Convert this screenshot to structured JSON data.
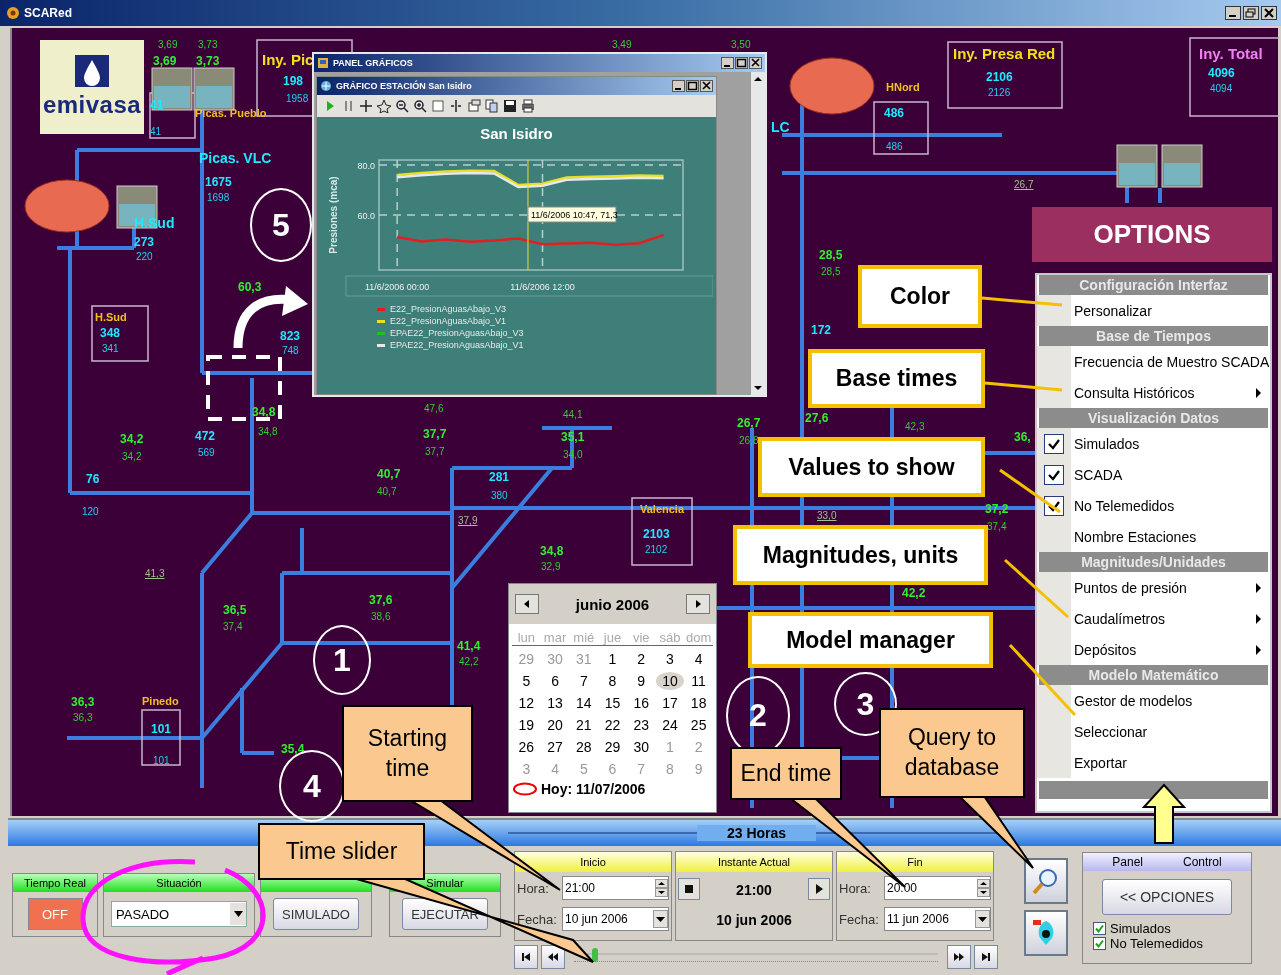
{
  "window": {
    "title": "SCARed"
  },
  "logo": {
    "text": "emivasa"
  },
  "diagram": {
    "labels": [
      {
        "text": "3,69",
        "kind": "reading_small"
      },
      {
        "text": "3,73",
        "kind": "reading_small"
      },
      {
        "text": "3,69",
        "kind": "reading"
      },
      {
        "text": "3,73",
        "kind": "reading"
      },
      {
        "text": "41",
        "kind": "flow"
      },
      {
        "text": "41",
        "kind": "flow_small"
      },
      {
        "text": "Picas. Pueblo",
        "kind": "station"
      },
      {
        "text": "Iny. Pic",
        "kind": "injection"
      },
      {
        "text": "198",
        "kind": "flow"
      },
      {
        "text": "1958",
        "kind": "flow_small"
      },
      {
        "text": "Picas. VLC",
        "kind": "station_big"
      },
      {
        "text": "1675",
        "kind": "flow"
      },
      {
        "text": "1698",
        "kind": "flow_small"
      },
      {
        "text": "H.Sud",
        "kind": "station_big"
      },
      {
        "text": "273",
        "kind": "flow"
      },
      {
        "text": "220",
        "kind": "flow_small"
      },
      {
        "text": "H.Sud",
        "kind": "station"
      },
      {
        "text": "348",
        "kind": "flow"
      },
      {
        "text": "341",
        "kind": "flow_small"
      },
      {
        "text": "60,3",
        "kind": "reading"
      },
      {
        "text": "823",
        "kind": "flow"
      },
      {
        "text": "748",
        "kind": "flow_small"
      },
      {
        "text": "34,8",
        "kind": "reading"
      },
      {
        "text": "34,8",
        "kind": "reading_small"
      },
      {
        "text": "34,2",
        "kind": "reading"
      },
      {
        "text": "34,2",
        "kind": "reading_small"
      },
      {
        "text": "472",
        "kind": "flow"
      },
      {
        "text": "569",
        "kind": "flow_small"
      },
      {
        "text": "76",
        "kind": "flow"
      },
      {
        "text": "120",
        "kind": "flow_small"
      },
      {
        "text": "47,6",
        "kind": "reading_small"
      },
      {
        "text": "44,1",
        "kind": "reading_small"
      },
      {
        "text": "37,7",
        "kind": "reading"
      },
      {
        "text": "37,7",
        "kind": "reading_small"
      },
      {
        "text": "35,1",
        "kind": "reading"
      },
      {
        "text": "34,0",
        "kind": "reading_small"
      },
      {
        "text": "40,7",
        "kind": "reading"
      },
      {
        "text": "40,7",
        "kind": "reading_small"
      },
      {
        "text": "281",
        "kind": "flow"
      },
      {
        "text": "380",
        "kind": "flow_small"
      },
      {
        "text": "37,9",
        "kind": "link"
      },
      {
        "text": "41,3",
        "kind": "link"
      },
      {
        "text": "34,8",
        "kind": "reading"
      },
      {
        "text": "32,9",
        "kind": "reading_small"
      },
      {
        "text": "36,5",
        "kind": "reading"
      },
      {
        "text": "37,4",
        "kind": "reading_small"
      },
      {
        "text": "37,6",
        "kind": "reading"
      },
      {
        "text": "38,6",
        "kind": "reading_small"
      },
      {
        "text": "41,4",
        "kind": "reading"
      },
      {
        "text": "42,2",
        "kind": "reading_small"
      },
      {
        "text": "36,3",
        "kind": "reading"
      },
      {
        "text": "36,3",
        "kind": "reading_small"
      },
      {
        "text": "Pinedo",
        "kind": "station"
      },
      {
        "text": "101",
        "kind": "flow"
      },
      {
        "text": "101",
        "kind": "flow_small"
      },
      {
        "text": "35,4",
        "kind": "reading"
      },
      {
        "text": "3,49",
        "kind": "reading_small"
      },
      {
        "text": "3,50",
        "kind": "reading_small"
      },
      {
        "text": "HNord",
        "kind": "station"
      },
      {
        "text": "486",
        "kind": "flow"
      },
      {
        "text": "486",
        "kind": "flow_small"
      },
      {
        "text": "Iny. Presa Red",
        "kind": "injection"
      },
      {
        "text": "2106",
        "kind": "flow"
      },
      {
        "text": "2126",
        "kind": "flow_small"
      },
      {
        "text": "Iny. Total",
        "kind": "injection_total"
      },
      {
        "text": "4096",
        "kind": "flow"
      },
      {
        "text": "4094",
        "kind": "flow_small"
      },
      {
        "text": "26,7",
        "kind": "link"
      },
      {
        "text": "LC",
        "kind": "station_big"
      },
      {
        "text": "28,5",
        "kind": "reading"
      },
      {
        "text": "28,5",
        "kind": "reading_small"
      },
      {
        "text": "172",
        "kind": "flow"
      },
      {
        "text": "26,7",
        "kind": "reading"
      },
      {
        "text": "26,8",
        "kind": "reading_small"
      },
      {
        "text": "27,6",
        "kind": "reading"
      },
      {
        "text": "42,3",
        "kind": "reading_small"
      },
      {
        "text": "36,",
        "kind": "reading"
      },
      {
        "text": "Valencia",
        "kind": "station"
      },
      {
        "text": "2103",
        "kind": "flow"
      },
      {
        "text": "2102",
        "kind": "flow_small"
      },
      {
        "text": "33,0",
        "kind": "link"
      },
      {
        "text": "37,2",
        "kind": "reading"
      },
      {
        "text": "37,4",
        "kind": "reading_small"
      },
      {
        "text": "42,2",
        "kind": "reading"
      }
    ]
  },
  "chart_window": {
    "outer_title": "PANEL GRÁFICOS",
    "inner_title": "GRÁFICO ESTACIÓN San Isidro",
    "chart_data": {
      "type": "line",
      "title": "San Isidro",
      "ylabel": "Presiones (mca)",
      "categories": [
        "11/6/2006 00:00",
        null,
        null,
        null,
        null,
        null,
        "11/6/2006 12:00",
        null,
        null,
        null,
        null,
        null
      ],
      "series": [
        {
          "name": "E22_PresionAguasAbajo_V3",
          "color": "#e02020",
          "values": [
            51.2,
            49.4,
            50.2,
            49.3,
            49.8,
            50.6,
            48.3,
            48.6,
            48.9,
            48.1,
            48.7,
            52.0
          ]
        },
        {
          "name": "E22_PresionAguasAbajo_V1",
          "color": "#e8e020",
          "values": [
            76.0,
            76.8,
            77.4,
            77.7,
            77.6,
            72.0,
            72.5,
            75.0,
            75.3,
            75.5,
            75.8,
            75.6
          ]
        },
        {
          "name": "EPAE22_PresionAguasAbajo_V3",
          "color": "#20c020",
          "values": [
            null,
            null,
            null,
            null,
            null,
            null,
            null,
            null,
            null,
            null,
            null,
            null
          ]
        },
        {
          "name": "EPAE22_PresionAguasAbajo_V1",
          "color": "#e8e8e8",
          "values": [
            75.1,
            75.9,
            76.5,
            76.8,
            76.6,
            71.2,
            71.7,
            74.1,
            74.4,
            74.6,
            74.9,
            74.7
          ]
        }
      ],
      "ylim": [
        38,
        82
      ],
      "grid": true,
      "yticks": [
        {
          "value": 60,
          "label": "60.0"
        },
        {
          "value": 80,
          "label": "80.0"
        }
      ],
      "annotations": [
        "11/6/2006 10:47, 71,3"
      ]
    }
  },
  "calendar": {
    "month": "junio 2006",
    "weekdays": [
      "lun",
      "mar",
      "mié",
      "jue",
      "vie",
      "sáb",
      "dom"
    ],
    "weeks": [
      [
        {
          "day": "29",
          "in_month": false,
          "selected": false
        },
        {
          "day": "30",
          "in_month": false,
          "selected": false
        },
        {
          "day": "31",
          "in_month": false,
          "selected": false
        },
        {
          "day": "1",
          "in_month": true,
          "selected": false
        },
        {
          "day": "2",
          "in_month": true,
          "selected": false
        },
        {
          "day": "3",
          "in_month": true,
          "selected": false
        },
        {
          "day": "4",
          "in_month": true,
          "selected": false
        }
      ],
      [
        {
          "day": "5",
          "in_month": true,
          "selected": false
        },
        {
          "day": "6",
          "in_month": true,
          "selected": false
        },
        {
          "day": "7",
          "in_month": true,
          "selected": false
        },
        {
          "day": "8",
          "in_month": true,
          "selected": false
        },
        {
          "day": "9",
          "in_month": true,
          "selected": false
        },
        {
          "day": "10",
          "in_month": true,
          "selected": true
        },
        {
          "day": "11",
          "in_month": true,
          "selected": false
        }
      ],
      [
        {
          "day": "12",
          "in_month": true,
          "selected": false
        },
        {
          "day": "13",
          "in_month": true,
          "selected": false
        },
        {
          "day": "14",
          "in_month": true,
          "selected": false
        },
        {
          "day": "15",
          "in_month": true,
          "selected": false
        },
        {
          "day": "16",
          "in_month": true,
          "selected": false
        },
        {
          "day": "17",
          "in_month": true,
          "selected": false
        },
        {
          "day": "18",
          "in_month": true,
          "selected": false
        }
      ],
      [
        {
          "day": "19",
          "in_month": true,
          "selected": false
        },
        {
          "day": "20",
          "in_month": true,
          "selected": false
        },
        {
          "day": "21",
          "in_month": true,
          "selected": false
        },
        {
          "day": "22",
          "in_month": true,
          "selected": false
        },
        {
          "day": "23",
          "in_month": true,
          "selected": false
        },
        {
          "day": "24",
          "in_month": true,
          "selected": false
        },
        {
          "day": "25",
          "in_month": true,
          "selected": false
        }
      ],
      [
        {
          "day": "26",
          "in_month": true,
          "selected": false
        },
        {
          "day": "27",
          "in_month": true,
          "selected": false
        },
        {
          "day": "28",
          "in_month": true,
          "selected": false
        },
        {
          "day": "29",
          "in_month": true,
          "selected": false
        },
        {
          "day": "30",
          "in_month": true,
          "selected": false
        },
        {
          "day": "1",
          "in_month": false,
          "selected": false
        },
        {
          "day": "2",
          "in_month": false,
          "selected": false
        }
      ],
      [
        {
          "day": "3",
          "in_month": false,
          "selected": false
        },
        {
          "day": "4",
          "in_month": false,
          "selected": false
        },
        {
          "day": "5",
          "in_month": false,
          "selected": false
        },
        {
          "day": "6",
          "in_month": false,
          "selected": false
        },
        {
          "day": "7",
          "in_month": false,
          "selected": false
        },
        {
          "day": "8",
          "in_month": false,
          "selected": false
        },
        {
          "day": "9",
          "in_month": false,
          "selected": false
        }
      ]
    ],
    "today": "Hoy: 11/07/2006"
  },
  "options_menu": {
    "title": "OPTIONS",
    "sections": [
      {
        "header": "Configuración Interfaz",
        "items": [
          {
            "label": "Personalizar",
            "kind": "plain"
          }
        ]
      },
      {
        "header": "Base de Tiempos",
        "items": [
          {
            "label": "Frecuencia de Muestro SCADA",
            "kind": "plain"
          },
          {
            "label": "Consulta Históricos",
            "kind": "submenu"
          }
        ]
      },
      {
        "header": "Visualización Datos",
        "items": [
          {
            "label": "Simulados",
            "kind": "check",
            "checked": true
          },
          {
            "label": "SCADA",
            "kind": "check",
            "checked": true
          },
          {
            "label": "No Telemedidos",
            "kind": "check",
            "checked": true
          },
          {
            "label": "Nombre Estaciones",
            "kind": "check",
            "checked": false
          }
        ]
      },
      {
        "header": "Magnitudes/Unidades",
        "items": [
          {
            "label": "Puntos de presión",
            "kind": "submenu"
          },
          {
            "label": "Caudalímetros",
            "kind": "submenu"
          },
          {
            "label": "Depósitos",
            "kind": "submenu"
          }
        ]
      },
      {
        "header": "Modelo Matemático",
        "items": [
          {
            "label": "Gestor de modelos",
            "kind": "plain"
          },
          {
            "label": "Seleccionar",
            "kind": "plain"
          },
          {
            "label": "Exportar",
            "kind": "plain"
          }
        ]
      }
    ]
  },
  "annotations": {
    "labels": [
      "Color",
      "Base times",
      "Values to show",
      "Magnitudes, units",
      "Model manager"
    ],
    "circled_numbers": [
      "5",
      "1",
      "4",
      "2",
      "3"
    ],
    "callouts": [
      "Starting time",
      "End time",
      "Query to database",
      "Time slider"
    ]
  },
  "bottom_panel": {
    "range_label": "23 Horas",
    "mode_groups": [
      {
        "header": "Tiempo Real",
        "kind": "toggle",
        "value": "OFF"
      },
      {
        "header": "Situación",
        "kind": "select",
        "value": "PASADO"
      },
      {
        "kind": "button",
        "value": "SIMULADO"
      },
      {
        "header": "Simular",
        "kind": "button",
        "value": "EJECUTAR"
      }
    ],
    "start": {
      "header": "Inicio",
      "hour_label": "Hora:",
      "hour": "21:00",
      "date_label": "Fecha:",
      "date": "10 jun 2006"
    },
    "current": {
      "header": "Instante Actual",
      "time": "21:00",
      "date": "10 jun 2006"
    },
    "end": {
      "header": "Fin",
      "hour_label": "Hora:",
      "hour": "20:00",
      "date_label": "Fecha:",
      "date": "11 jun 2006"
    },
    "time_slider": {
      "level": 0.05
    },
    "panel_control": {
      "header_left": "Panel",
      "header_right": "Control",
      "button": "<< OPCIONES",
      "checks": [
        {
          "label": "Simulados",
          "checked": true
        },
        {
          "label": "No Telemedidos",
          "checked": true
        }
      ]
    }
  }
}
